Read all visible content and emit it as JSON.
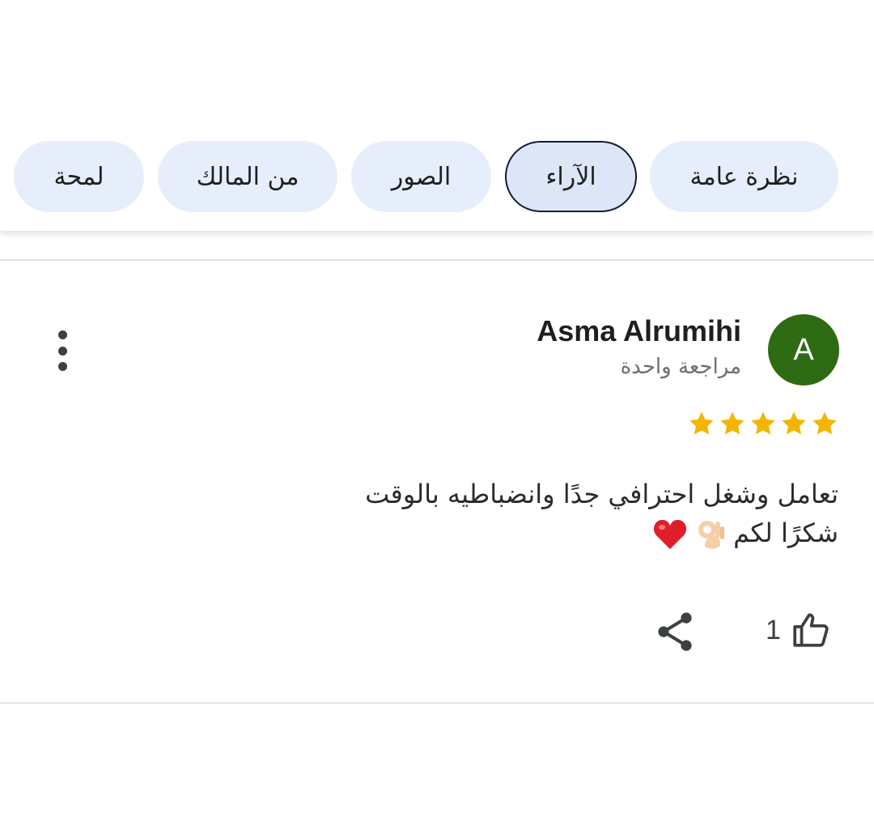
{
  "tabs": [
    {
      "label": "نظرة عامة",
      "active": false
    },
    {
      "label": "الآراء",
      "active": true
    },
    {
      "label": "الصور",
      "active": false
    },
    {
      "label": "من المالك",
      "active": false
    },
    {
      "label": "لمحة",
      "active": false
    }
  ],
  "review": {
    "avatar_letter": "A",
    "avatar_color": "#2e6b12",
    "author": "Asma Alrumihi",
    "author_meta": "مراجعة واحدة",
    "rating": 5,
    "star_color": "#f4b400",
    "text_line1": "تعامل وشغل احترافي جدًا وانضباطيه بالوقت",
    "text_line2": "شكرًا لكم",
    "emojis": [
      "ok-hand-emoji",
      "red-heart-emoji"
    ],
    "like_count": "1"
  },
  "icons": {
    "menu": "more-vert-icon",
    "like": "thumb-up-icon",
    "share": "share-icon"
  }
}
